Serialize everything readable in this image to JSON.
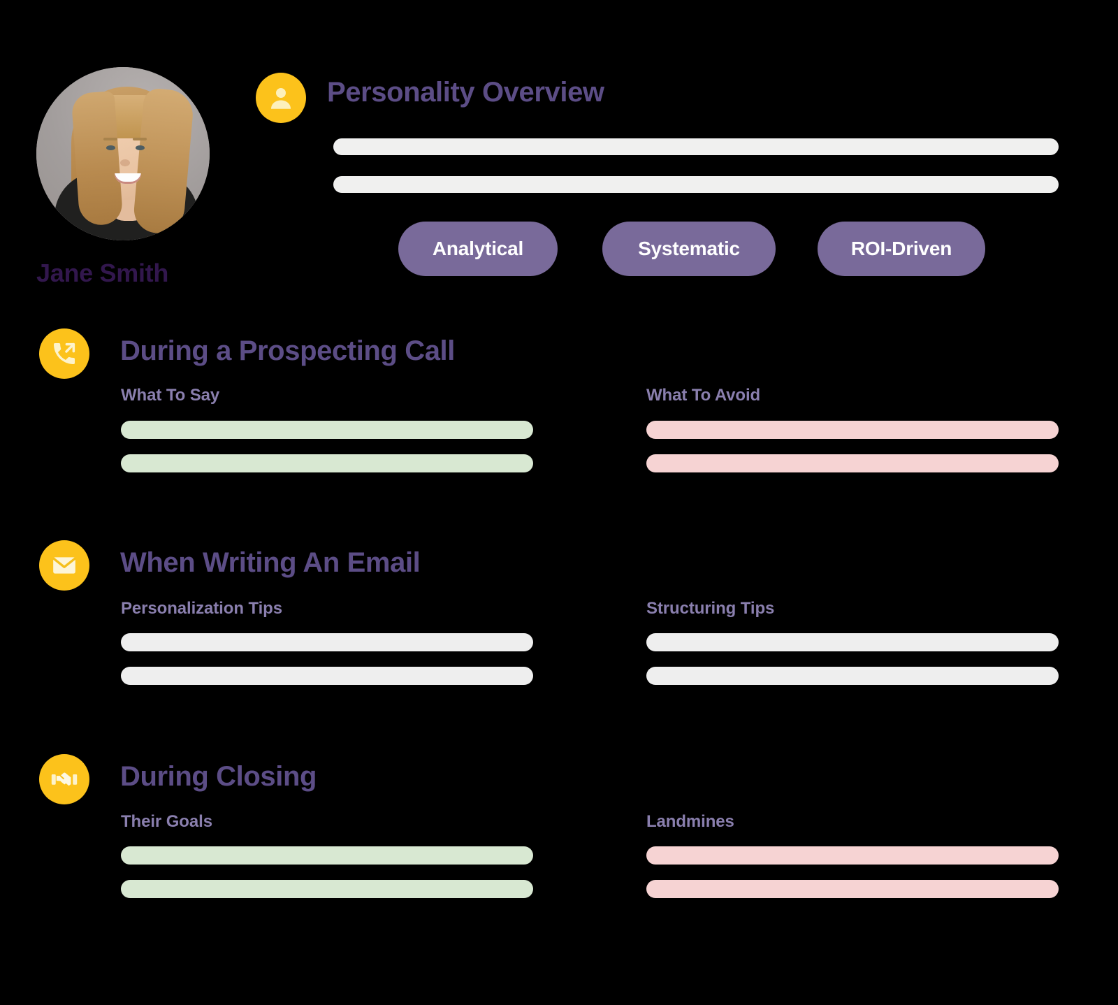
{
  "profile": {
    "name": "Jane Smith",
    "avatar_icon": "user-portrait-photo"
  },
  "overview": {
    "icon": "person-icon",
    "title": "Personality Overview",
    "placeholder_lines": 2,
    "traits": [
      "Analytical",
      "Systematic",
      "ROI-Driven"
    ]
  },
  "sections": [
    {
      "icon": "outgoing-call-icon",
      "title": "During a Prospecting Call",
      "left_column": {
        "heading": "What To Say",
        "tone": "positive",
        "lines": 2
      },
      "right_column": {
        "heading": "What To Avoid",
        "tone": "negative",
        "lines": 2
      }
    },
    {
      "icon": "envelope-icon",
      "title": "When Writing An Email",
      "left_column": {
        "heading": "Personalization Tips",
        "tone": "neutral",
        "lines": 2
      },
      "right_column": {
        "heading": "Structuring Tips",
        "tone": "neutral",
        "lines": 2
      }
    },
    {
      "icon": "handshake-icon",
      "title": "During Closing",
      "left_column": {
        "heading": "Their Goals",
        "tone": "positive",
        "lines": 2
      },
      "right_column": {
        "heading": "Landmines",
        "tone": "negative",
        "lines": 2
      }
    }
  ],
  "colors": {
    "background": "#000000",
    "accent_yellow": "#fcc21b",
    "heading_purple": "#5c4d86",
    "subheading_purple": "#8a7fae",
    "name_purple": "#32174d",
    "pill_purple": "#796a9a",
    "positive_bar": "#d8e8d2",
    "negative_bar": "#f6d3d3",
    "neutral_bar": "#eeeeee",
    "white_bar": "#f0f0ef"
  }
}
